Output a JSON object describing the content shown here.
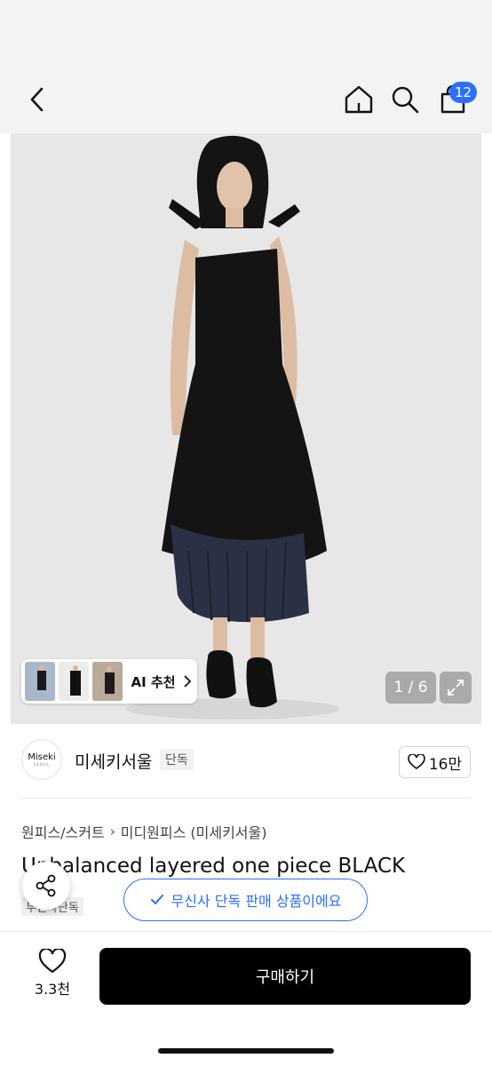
{
  "header": {
    "cart_badge": "12",
    "icons": [
      "back-icon",
      "home-icon",
      "search-icon",
      "cart-icon"
    ]
  },
  "gallery": {
    "ai_label": "AI 추천",
    "counter": "1 / 6",
    "expand_icon": "expand-icon"
  },
  "brand": {
    "logo_text": "Miseki",
    "logo_sub": "SEOUL",
    "name": "미세키서울",
    "tag": "단독",
    "likes": "16만"
  },
  "breadcrumbs": [
    "원피스/스커트",
    "미디원피스 (미세키서울)"
  ],
  "product": {
    "title": "Unbalanced layered one piece BLACK",
    "sub_tag": "무신사단독"
  },
  "toast": {
    "text": "무신사 단독 판매 상품이에요"
  },
  "bottom": {
    "wish_count": "3.3천",
    "buy_label": "구매하기"
  },
  "colors": {
    "accent": "#2b6fff",
    "buy_button": "#000000",
    "header_bg": "#f3f3f3"
  }
}
